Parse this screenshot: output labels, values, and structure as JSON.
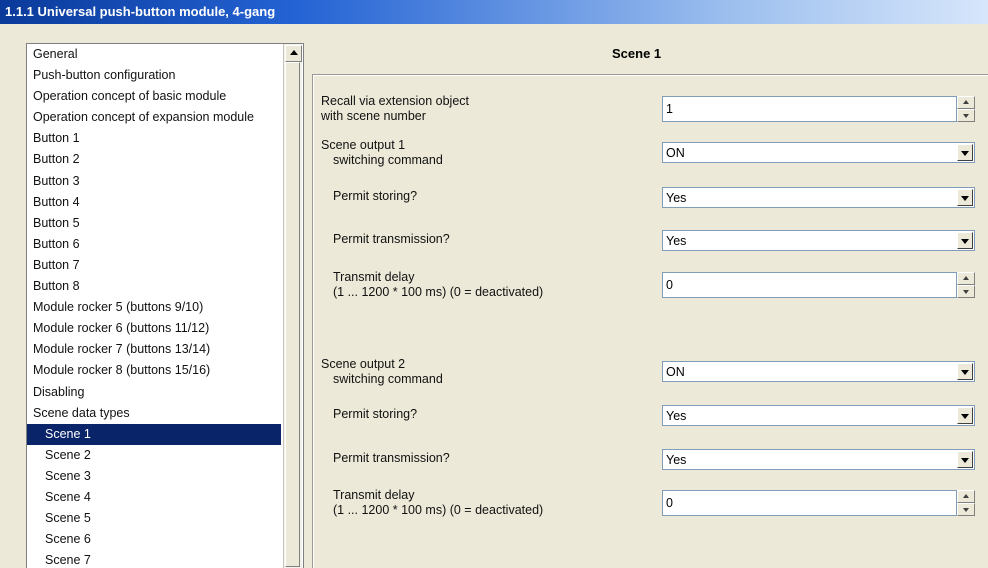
{
  "window": {
    "title": "1.1.1 Universal push-button module, 4-gang"
  },
  "tree": {
    "items": [
      {
        "label": "General"
      },
      {
        "label": "Push-button configuration"
      },
      {
        "label": "Operation concept of basic module"
      },
      {
        "label": "Operation concept of expansion module"
      },
      {
        "label": "Button 1"
      },
      {
        "label": "Button 2"
      },
      {
        "label": "Button 3"
      },
      {
        "label": "Button 4"
      },
      {
        "label": "Button 5"
      },
      {
        "label": "Button 6"
      },
      {
        "label": "Button 7"
      },
      {
        "label": "Button 8"
      },
      {
        "label": "Module rocker 5 (buttons 9/10)"
      },
      {
        "label": "Module rocker 6 (buttons 11/12)"
      },
      {
        "label": "Module rocker 7 (buttons 13/14)"
      },
      {
        "label": "Module rocker 8 (buttons 15/16)"
      },
      {
        "label": "Disabling"
      },
      {
        "label": "Scene data types"
      },
      {
        "label": "Scene 1",
        "selected": true
      },
      {
        "label": "Scene 2"
      },
      {
        "label": "Scene 3"
      },
      {
        "label": "Scene 4"
      },
      {
        "label": "Scene 5"
      },
      {
        "label": "Scene 6"
      },
      {
        "label": "Scene 7"
      }
    ]
  },
  "panel": {
    "title": "Scene 1",
    "recall": {
      "label1": "Recall via extension object",
      "label2": "with scene number",
      "value": "1"
    },
    "out1": {
      "label1": "Scene output 1",
      "label2": "switching command",
      "value": "ON",
      "storing_label": "Permit storing?",
      "storing_value": "Yes",
      "transmission_label": "Permit transmission?",
      "transmission_value": "Yes",
      "delay_label1": "Transmit delay",
      "delay_label2": "(1 ... 1200 * 100 ms) (0 = deactivated)",
      "delay_value": "0"
    },
    "out2": {
      "label1": "Scene output 2",
      "label2": "switching command",
      "value": "ON",
      "storing_label": "Permit storing?",
      "storing_value": "Yes",
      "transmission_label": "Permit transmission?",
      "transmission_value": "Yes",
      "delay_label1": "Transmit delay",
      "delay_label2": "(1 ... 1200 * 100 ms) (0 = deactivated)",
      "delay_value": "0"
    }
  }
}
